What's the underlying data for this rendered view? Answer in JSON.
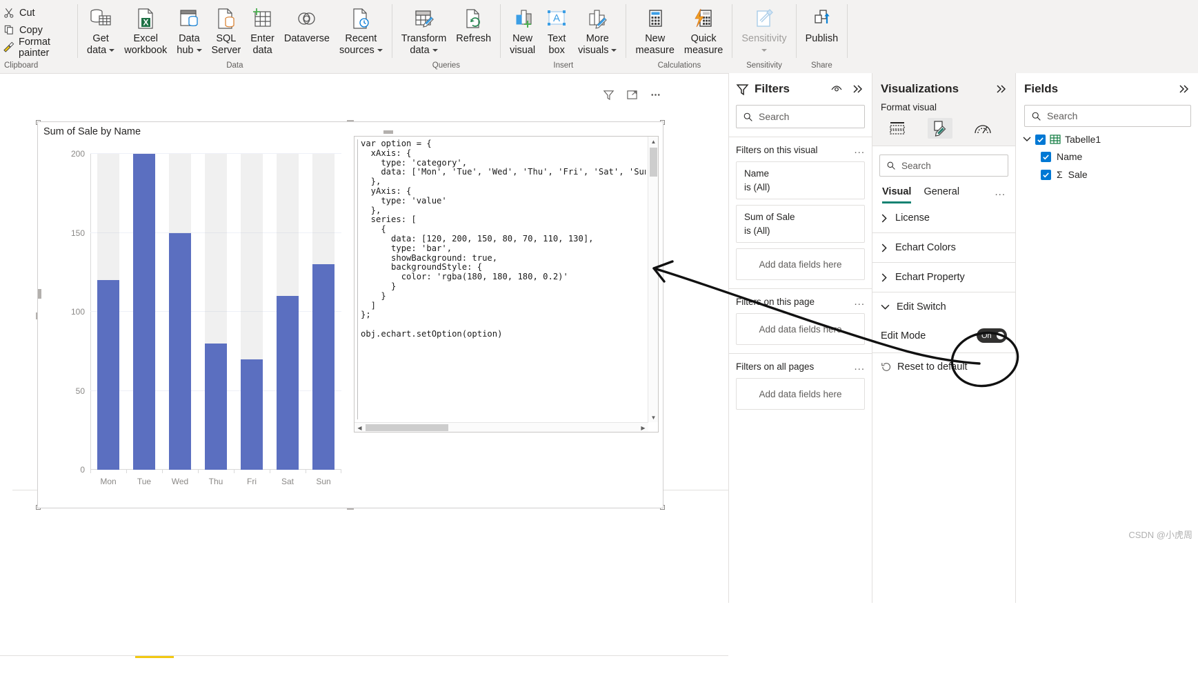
{
  "ribbon": {
    "clipboard": {
      "group_label": "Clipboard",
      "items": [
        {
          "label": "Cut",
          "icon": "scissors-icon"
        },
        {
          "label": "Copy",
          "icon": "copy-icon"
        },
        {
          "label": "Format painter",
          "icon": "format-painter-icon"
        }
      ]
    },
    "groups": [
      {
        "group_label": "Data",
        "buttons": [
          {
            "line1": "Get",
            "line2": "data",
            "icon": "get-data-icon",
            "dropdown": true
          },
          {
            "line1": "Excel",
            "line2": "workbook",
            "icon": "excel-workbook-icon",
            "dropdown": false
          },
          {
            "line1": "Data",
            "line2": "hub",
            "icon": "data-hub-icon",
            "dropdown": true
          },
          {
            "line1": "SQL",
            "line2": "Server",
            "icon": "sql-server-icon",
            "dropdown": false
          },
          {
            "line1": "Enter",
            "line2": "data",
            "icon": "enter-data-icon",
            "dropdown": false
          },
          {
            "line1": "Dataverse",
            "line2": "",
            "icon": "dataverse-icon",
            "dropdown": false
          },
          {
            "line1": "Recent",
            "line2": "sources",
            "icon": "recent-sources-icon",
            "dropdown": true
          }
        ]
      },
      {
        "group_label": "Queries",
        "buttons": [
          {
            "line1": "Transform",
            "line2": "data",
            "icon": "transform-data-icon",
            "dropdown": true
          },
          {
            "line1": "Refresh",
            "line2": "",
            "icon": "refresh-icon",
            "dropdown": false
          }
        ]
      },
      {
        "group_label": "Insert",
        "buttons": [
          {
            "line1": "New",
            "line2": "visual",
            "icon": "new-visual-icon",
            "dropdown": false
          },
          {
            "line1": "Text",
            "line2": "box",
            "icon": "text-box-icon",
            "dropdown": false
          },
          {
            "line1": "More",
            "line2": "visuals",
            "icon": "more-visuals-icon",
            "dropdown": true
          }
        ]
      },
      {
        "group_label": "Calculations",
        "buttons": [
          {
            "line1": "New",
            "line2": "measure",
            "icon": "new-measure-icon",
            "dropdown": false
          },
          {
            "line1": "Quick",
            "line2": "measure",
            "icon": "quick-measure-icon",
            "dropdown": false
          }
        ]
      },
      {
        "group_label": "Sensitivity",
        "buttons": [
          {
            "line1": "Sensitivity",
            "line2": "",
            "icon": "sensitivity-icon",
            "dropdown": true,
            "disabled": true
          }
        ]
      },
      {
        "group_label": "Share",
        "buttons": [
          {
            "line1": "Publish",
            "line2": "",
            "icon": "publish-icon",
            "dropdown": false
          }
        ]
      }
    ]
  },
  "visual": {
    "title": "Sum of Sale by Name",
    "toolbar": [
      {
        "name": "filter-icon"
      },
      {
        "name": "focus-mode-icon"
      },
      {
        "name": "more-options-icon"
      }
    ],
    "code": "var option = {\n  xAxis: {\n    type: 'category',\n    data: ['Mon', 'Tue', 'Wed', 'Thu', 'Fri', 'Sat', 'Sun']\n  },\n  yAxis: {\n    type: 'value'\n  },\n  series: [\n    {\n      data: [120, 200, 150, 80, 70, 110, 130],\n      type: 'bar',\n      showBackground: true,\n      backgroundStyle: {\n        color: 'rgba(180, 180, 180, 0.2)'\n      }\n    }\n  ]\n};\n\nobj.echart.setOption(option)"
  },
  "chart_data": {
    "type": "bar",
    "title": "Sum of Sale by Name",
    "categories": [
      "Mon",
      "Tue",
      "Wed",
      "Thu",
      "Fri",
      "Sat",
      "Sun"
    ],
    "values": [
      120,
      200,
      150,
      80,
      70,
      110,
      130
    ],
    "xlabel": "",
    "ylabel": "",
    "ylim": [
      0,
      200
    ],
    "yticks": [
      0,
      50,
      100,
      150,
      200
    ],
    "grid": true,
    "legend": "none",
    "bar_color": "#5b6fc0",
    "bar_background_color": "rgba(180, 180, 180, 0.2)",
    "show_background": true
  },
  "filters": {
    "title": "Filters",
    "search_placeholder": "Search",
    "header_icons": [
      {
        "name": "hide-filters-icon"
      },
      {
        "name": "expand-filters-icon"
      }
    ],
    "sections": [
      {
        "label": "Filters on this visual",
        "cards": [
          {
            "field": "Name",
            "value": "is (All)"
          },
          {
            "field": "Sum of Sale",
            "value": "is (All)"
          }
        ],
        "dropzone": "Add data fields here"
      },
      {
        "label": "Filters on this page",
        "cards": [],
        "dropzone": "Add data fields here"
      },
      {
        "label": "Filters on all pages",
        "cards": [],
        "dropzone": "Add data fields here"
      }
    ]
  },
  "visualizations": {
    "title": "Visualizations",
    "expand_icon": "expand-pane-icon",
    "subtitle": "Format visual",
    "tabs": [
      {
        "name": "fields-tab-icon",
        "selected": false
      },
      {
        "name": "format-tab-icon",
        "selected": true
      },
      {
        "name": "analytics-tab-icon",
        "selected": false
      }
    ],
    "search_placeholder": "Search",
    "pivots": [
      {
        "label": "Visual",
        "active": true
      },
      {
        "label": "General",
        "active": false
      }
    ],
    "more_label": "...",
    "accordions": [
      {
        "label": "License",
        "expanded": false
      },
      {
        "label": "Echart Colors",
        "expanded": false
      },
      {
        "label": "Echart Property",
        "expanded": false
      },
      {
        "label": "Edit Switch",
        "expanded": true
      }
    ],
    "edit_mode": {
      "label": "Edit Mode",
      "toggle_text": "On",
      "state": "on"
    },
    "reset": {
      "label": "Reset to default",
      "icon": "reset-icon"
    },
    "accent_color": "#118272"
  },
  "fields": {
    "title": "Fields",
    "search_placeholder": "Search",
    "tables": [
      {
        "name": "Tabelle1",
        "icon": "table-icon",
        "fields": [
          {
            "label": "Name",
            "checked": true,
            "icon": ""
          },
          {
            "label": "Sale",
            "checked": true,
            "icon": "sigma-icon"
          }
        ]
      }
    ]
  },
  "watermark": "CSDN @小虎周"
}
